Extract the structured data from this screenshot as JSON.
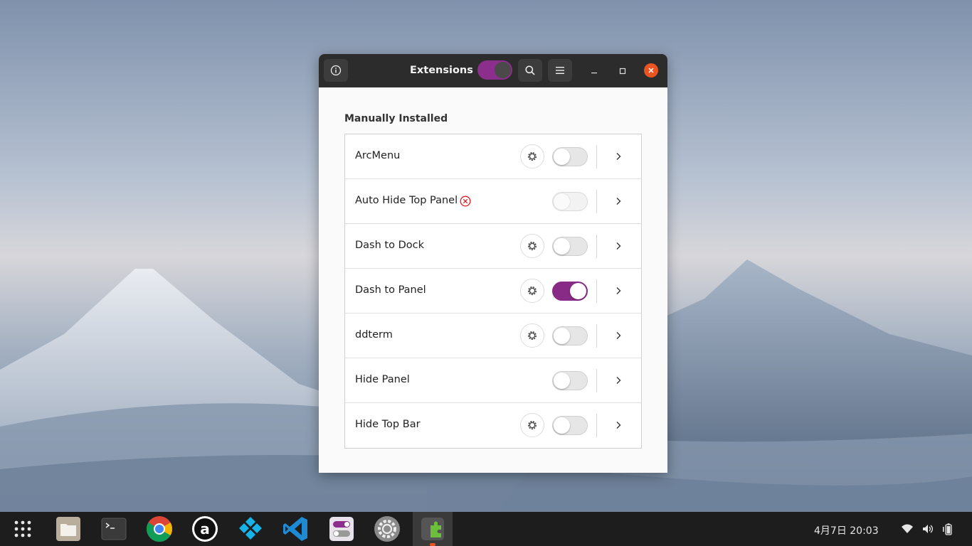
{
  "window": {
    "title": "Extensions",
    "master_enabled": true
  },
  "section": {
    "title": "Manually Installed"
  },
  "extensions": [
    {
      "name": "ArcMenu",
      "has_settings": true,
      "enabled": false,
      "error": false
    },
    {
      "name": "Auto Hide Top Panel",
      "has_settings": false,
      "enabled": false,
      "error": true
    },
    {
      "name": "Dash to Dock",
      "has_settings": true,
      "enabled": false,
      "error": false
    },
    {
      "name": "Dash to Panel",
      "has_settings": true,
      "enabled": true,
      "error": false
    },
    {
      "name": "ddterm",
      "has_settings": true,
      "enabled": false,
      "error": false
    },
    {
      "name": "Hide Panel",
      "has_settings": false,
      "enabled": false,
      "error": false
    },
    {
      "name": "Hide Top Bar",
      "has_settings": true,
      "enabled": false,
      "error": false
    }
  ],
  "taskbar": {
    "apps": [
      {
        "name": "show-apps-icon"
      },
      {
        "name": "files-icon"
      },
      {
        "name": "terminal-icon"
      },
      {
        "name": "chrome-icon"
      },
      {
        "name": "a-app-icon"
      },
      {
        "name": "kodi-icon"
      },
      {
        "name": "vscode-icon"
      },
      {
        "name": "tweaks-icon"
      },
      {
        "name": "settings-icon"
      },
      {
        "name": "extensions-app-icon"
      }
    ],
    "clock": "4月7日  20:03"
  },
  "colors": {
    "accent": "#872b87",
    "close": "#e95420",
    "titlebar": "#2c2c2c",
    "error": "#e01b24"
  }
}
